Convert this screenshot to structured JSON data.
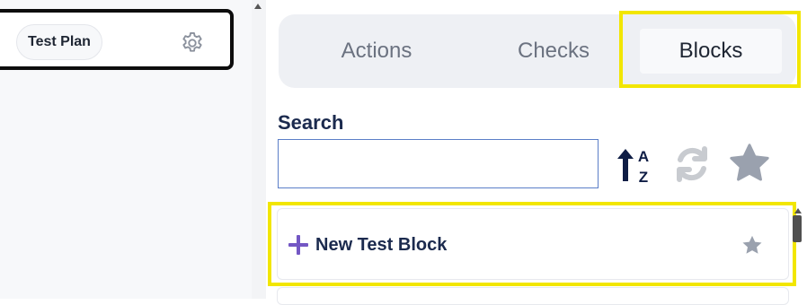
{
  "node": {
    "label": "Test Plan",
    "settings_icon": "gear-icon"
  },
  "tabs": [
    {
      "label": "Actions",
      "active": false
    },
    {
      "label": "Checks",
      "active": false
    },
    {
      "label": "Blocks",
      "active": true
    }
  ],
  "search": {
    "label": "Search",
    "value": "",
    "placeholder": ""
  },
  "toolbar": {
    "sort_icon": "sort-alpha-asc-icon",
    "refresh_icon": "refresh-icon",
    "favorites_icon": "star-icon"
  },
  "blocks": {
    "items": [
      {
        "label": "New Test Block",
        "icon": "plus-icon",
        "favorite_icon": "star-icon"
      }
    ]
  },
  "colors": {
    "highlight": "#f2e600",
    "accent_purple": "#7357c4",
    "navy_text": "#1b2a4e",
    "muted_icon": "#9aa1ae",
    "disabled_icon": "#c8cbd0"
  }
}
